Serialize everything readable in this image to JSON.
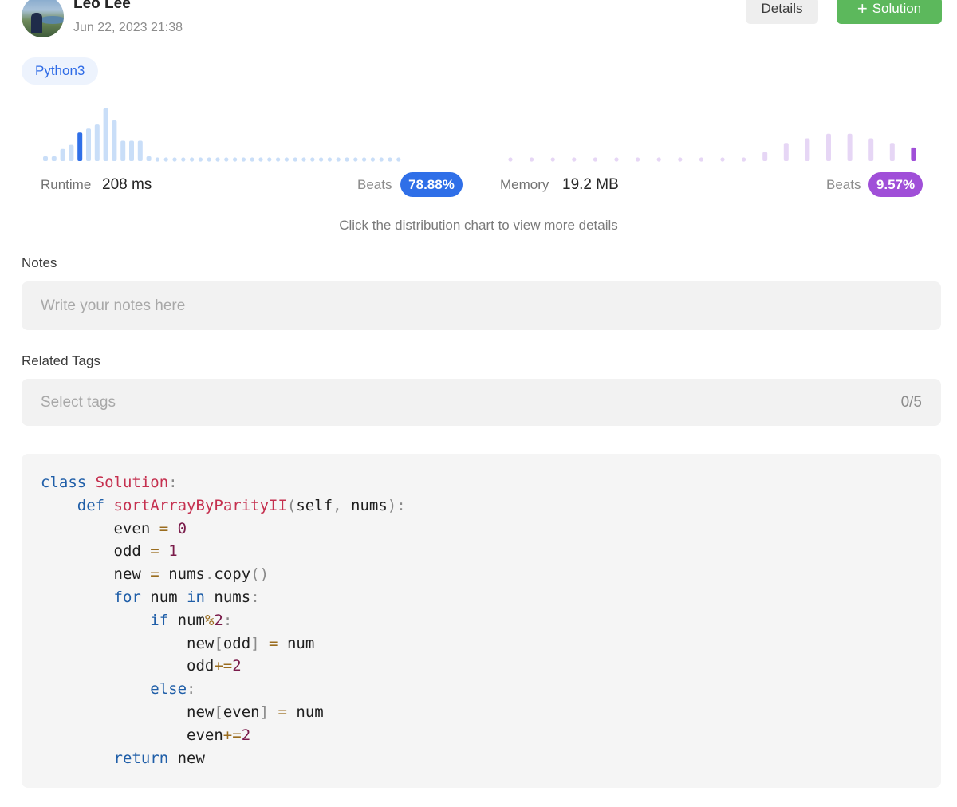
{
  "header": {
    "author": "Leo Lee",
    "date": "Jun 22, 2023 21:38",
    "details_label": "Details",
    "solution_label": "Solution",
    "solution_icon": "plus-icon"
  },
  "language_tag": "Python3",
  "runtime": {
    "label": "Runtime",
    "value": "208 ms",
    "beats_label": "Beats",
    "beats_value": "78.88%",
    "accent_color": "#2f6fe8"
  },
  "memory": {
    "label": "Memory",
    "value": "19.2 MB",
    "beats_label": "Beats",
    "beats_value": "9.57%",
    "accent_color": "#a04fd8"
  },
  "chart_hint": "Click the distribution chart to view more details",
  "chart_data": [
    {
      "type": "bar",
      "name": "runtime-distribution",
      "values": [
        1,
        1,
        3,
        4,
        7,
        8,
        9,
        13,
        10,
        5,
        5,
        5,
        1,
        0,
        0,
        0,
        0,
        0,
        0,
        0,
        0,
        0,
        0,
        0,
        0,
        0,
        0,
        0,
        0,
        0,
        0,
        0,
        0,
        0,
        0,
        0,
        0,
        0,
        0,
        0,
        0,
        0
      ],
      "highlight_index": 4,
      "base_color": "#c9def8",
      "highlight_color": "#2f6fe8"
    },
    {
      "type": "bar",
      "name": "memory-distribution",
      "values": [
        0,
        0,
        0,
        0,
        0,
        0,
        0,
        0,
        0,
        0,
        0,
        0,
        2,
        4,
        5,
        6,
        6,
        5,
        4,
        3
      ],
      "highlight_index": 19,
      "base_color": "#e6d6f5",
      "highlight_color": "#a04fd8"
    }
  ],
  "notes": {
    "label": "Notes",
    "placeholder": "Write your notes here"
  },
  "related_tags": {
    "label": "Related Tags",
    "placeholder": "Select tags",
    "count": "0/5"
  },
  "code": {
    "language": "python",
    "lines": [
      [
        [
          "keyword",
          "class"
        ],
        [
          "text",
          " "
        ],
        [
          "class",
          "Solution"
        ],
        [
          "punc",
          ":"
        ]
      ],
      [
        [
          "text",
          "    "
        ],
        [
          "keyword",
          "def"
        ],
        [
          "text",
          " "
        ],
        [
          "func",
          "sortArrayByParityII"
        ],
        [
          "punc",
          "("
        ],
        [
          "name",
          "self"
        ],
        [
          "punc",
          ", "
        ],
        [
          "name",
          "nums"
        ],
        [
          "punc",
          "):"
        ]
      ],
      [
        [
          "text",
          "        "
        ],
        [
          "name",
          "even"
        ],
        [
          "text",
          " "
        ],
        [
          "op",
          "="
        ],
        [
          "text",
          " "
        ],
        [
          "num",
          "0"
        ]
      ],
      [
        [
          "text",
          "        "
        ],
        [
          "name",
          "odd"
        ],
        [
          "text",
          " "
        ],
        [
          "op",
          "="
        ],
        [
          "text",
          " "
        ],
        [
          "num",
          "1"
        ]
      ],
      [
        [
          "text",
          "        "
        ],
        [
          "name",
          "new"
        ],
        [
          "text",
          " "
        ],
        [
          "op",
          "="
        ],
        [
          "text",
          " "
        ],
        [
          "name",
          "nums"
        ],
        [
          "punc",
          "."
        ],
        [
          "name",
          "copy"
        ],
        [
          "punc",
          "()"
        ]
      ],
      [
        [
          "text",
          "        "
        ],
        [
          "keyword",
          "for"
        ],
        [
          "text",
          " "
        ],
        [
          "name",
          "num"
        ],
        [
          "text",
          " "
        ],
        [
          "keyword",
          "in"
        ],
        [
          "text",
          " "
        ],
        [
          "name",
          "nums"
        ],
        [
          "punc",
          ":"
        ]
      ],
      [
        [
          "text",
          "            "
        ],
        [
          "keyword",
          "if"
        ],
        [
          "text",
          " "
        ],
        [
          "name",
          "num"
        ],
        [
          "op",
          "%"
        ],
        [
          "num",
          "2"
        ],
        [
          "punc",
          ":"
        ]
      ],
      [
        [
          "text",
          "                "
        ],
        [
          "name",
          "new"
        ],
        [
          "punc",
          "["
        ],
        [
          "name",
          "odd"
        ],
        [
          "punc",
          "]"
        ],
        [
          "text",
          " "
        ],
        [
          "op",
          "="
        ],
        [
          "text",
          " "
        ],
        [
          "name",
          "num"
        ]
      ],
      [
        [
          "text",
          "                "
        ],
        [
          "name",
          "odd"
        ],
        [
          "op",
          "+="
        ],
        [
          "num",
          "2"
        ]
      ],
      [
        [
          "text",
          "            "
        ],
        [
          "keyword",
          "else"
        ],
        [
          "punc",
          ":"
        ]
      ],
      [
        [
          "text",
          "                "
        ],
        [
          "name",
          "new"
        ],
        [
          "punc",
          "["
        ],
        [
          "name",
          "even"
        ],
        [
          "punc",
          "]"
        ],
        [
          "text",
          " "
        ],
        [
          "op",
          "="
        ],
        [
          "text",
          " "
        ],
        [
          "name",
          "num"
        ]
      ],
      [
        [
          "text",
          "                "
        ],
        [
          "name",
          "even"
        ],
        [
          "op",
          "+="
        ],
        [
          "num",
          "2"
        ]
      ],
      [
        [
          "text",
          "        "
        ],
        [
          "keyword",
          "return"
        ],
        [
          "text",
          " "
        ],
        [
          "name",
          "new"
        ]
      ]
    ]
  }
}
